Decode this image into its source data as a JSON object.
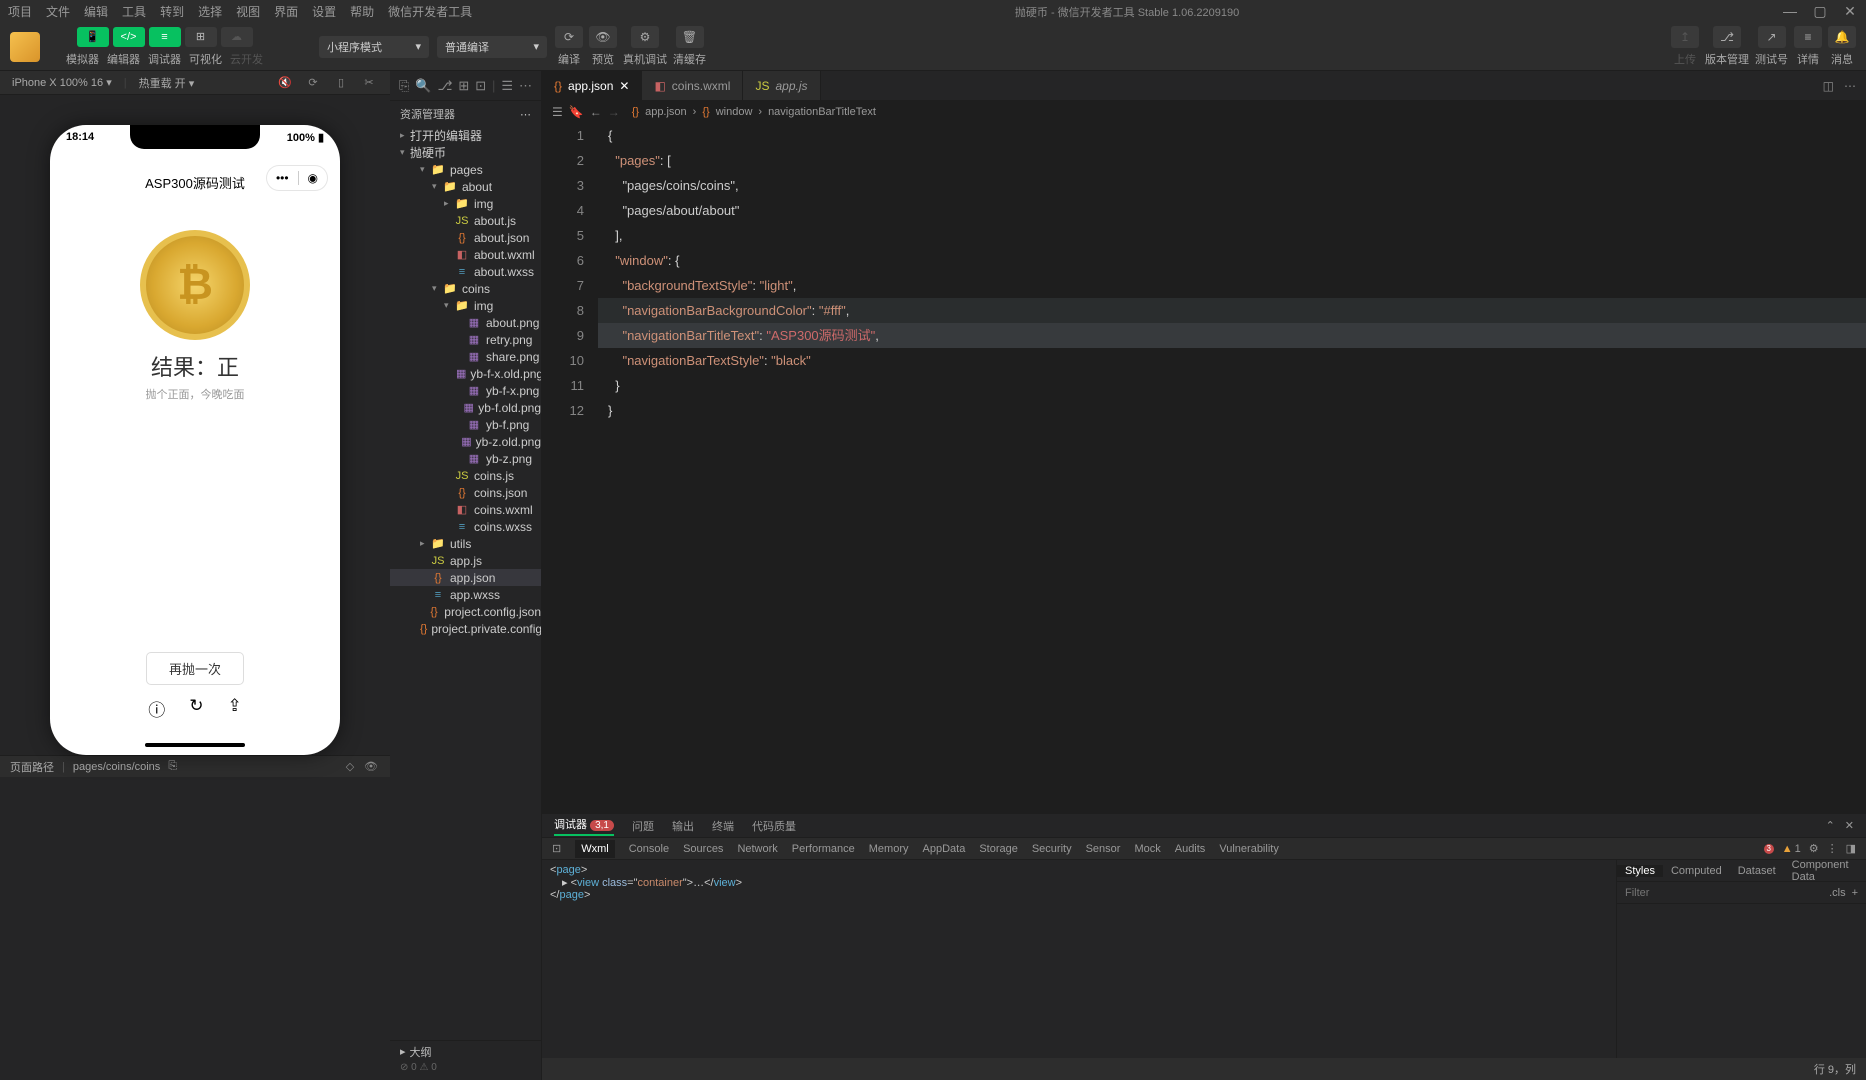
{
  "menubar": [
    "项目",
    "文件",
    "编辑",
    "工具",
    "转到",
    "选择",
    "视图",
    "界面",
    "设置",
    "帮助",
    "微信开发者工具"
  ],
  "window_title": "抛硬币 - 微信开发者工具 Stable 1.06.2209190",
  "toolbar": {
    "labels": [
      "模拟器",
      "编辑器",
      "调试器",
      "可视化",
      "云开发"
    ],
    "mode_dropdown": "小程序模式",
    "compile_dropdown": "普通编译",
    "compile_labels": [
      "编译",
      "预览",
      "真机调试",
      "清缓存"
    ],
    "right_labels": [
      "上传",
      "版本管理",
      "测试号",
      "详情",
      "消息"
    ]
  },
  "subheader": {
    "device": "iPhone X 100% 16",
    "hot_reload": "热重载 开"
  },
  "explorer": {
    "title": "资源管理器",
    "open_editors": "打开的编辑器",
    "project": "抛硬币",
    "outline": "大纲",
    "outline_stats": "⊘ 0 ⚠ 0"
  },
  "tree": [
    {
      "l": 2,
      "t": "folder",
      "c": "folder-yellow",
      "n": "pages",
      "exp": true
    },
    {
      "l": 3,
      "t": "folder",
      "c": "folder-yellow",
      "n": "about",
      "exp": true
    },
    {
      "l": 4,
      "t": "folder",
      "c": "folder-green",
      "n": "img",
      "exp": false
    },
    {
      "l": 4,
      "t": "file",
      "c": "js-yellow",
      "i": "JS",
      "n": "about.js"
    },
    {
      "l": 4,
      "t": "file",
      "c": "json-orange",
      "i": "{}",
      "n": "about.json"
    },
    {
      "l": 4,
      "t": "file",
      "c": "wxml-red",
      "i": "◧",
      "n": "about.wxml"
    },
    {
      "l": 4,
      "t": "file",
      "c": "wxss-blue",
      "i": "≡",
      "n": "about.wxss"
    },
    {
      "l": 3,
      "t": "folder",
      "c": "folder-yellow",
      "n": "coins",
      "exp": true
    },
    {
      "l": 4,
      "t": "folder",
      "c": "folder-green",
      "n": "img",
      "exp": true
    },
    {
      "l": 5,
      "t": "file",
      "c": "img-purple",
      "i": "▦",
      "n": "about.png"
    },
    {
      "l": 5,
      "t": "file",
      "c": "img-purple",
      "i": "▦",
      "n": "retry.png"
    },
    {
      "l": 5,
      "t": "file",
      "c": "img-purple",
      "i": "▦",
      "n": "share.png"
    },
    {
      "l": 5,
      "t": "file",
      "c": "img-purple",
      "i": "▦",
      "n": "yb-f-x.old.png"
    },
    {
      "l": 5,
      "t": "file",
      "c": "img-purple",
      "i": "▦",
      "n": "yb-f-x.png"
    },
    {
      "l": 5,
      "t": "file",
      "c": "img-purple",
      "i": "▦",
      "n": "yb-f.old.png"
    },
    {
      "l": 5,
      "t": "file",
      "c": "img-purple",
      "i": "▦",
      "n": "yb-f.png"
    },
    {
      "l": 5,
      "t": "file",
      "c": "img-purple",
      "i": "▦",
      "n": "yb-z.old.png"
    },
    {
      "l": 5,
      "t": "file",
      "c": "img-purple",
      "i": "▦",
      "n": "yb-z.png"
    },
    {
      "l": 4,
      "t": "file",
      "c": "js-yellow",
      "i": "JS",
      "n": "coins.js"
    },
    {
      "l": 4,
      "t": "file",
      "c": "json-orange",
      "i": "{}",
      "n": "coins.json"
    },
    {
      "l": 4,
      "t": "file",
      "c": "wxml-red",
      "i": "◧",
      "n": "coins.wxml"
    },
    {
      "l": 4,
      "t": "file",
      "c": "wxss-blue",
      "i": "≡",
      "n": "coins.wxss"
    },
    {
      "l": 2,
      "t": "folder",
      "c": "folder-yellow",
      "n": "utils",
      "exp": false
    },
    {
      "l": 2,
      "t": "file",
      "c": "js-yellow",
      "i": "JS",
      "n": "app.js"
    },
    {
      "l": 2,
      "t": "file",
      "c": "json-orange",
      "i": "{}",
      "n": "app.json",
      "sel": true
    },
    {
      "l": 2,
      "t": "file",
      "c": "wxss-blue",
      "i": "≡",
      "n": "app.wxss"
    },
    {
      "l": 2,
      "t": "file",
      "c": "json-orange",
      "i": "{}",
      "n": "project.config.json"
    },
    {
      "l": 2,
      "t": "file",
      "c": "json-orange",
      "i": "{}",
      "n": "project.private.config.js..."
    }
  ],
  "tabs": [
    {
      "icon": "{}",
      "color": "json-orange",
      "name": "app.json",
      "active": true,
      "close": true
    },
    {
      "icon": "◧",
      "color": "wxml-red",
      "name": "coins.wxml",
      "active": false
    },
    {
      "icon": "JS",
      "color": "js-yellow",
      "name": "app.js",
      "active": false,
      "italic": true
    }
  ],
  "breadcrumb": [
    "app.json",
    "{}",
    "window",
    "▢",
    "navigationBarTitleText"
  ],
  "code": {
    "lines": [
      "{",
      "  \"pages\": [",
      "    \"pages/coins/coins\",",
      "    \"pages/about/about\"",
      "  ],",
      "  \"window\": {",
      "    \"backgroundTextStyle\": \"light\",",
      "    \"navigationBarBackgroundColor\": \"#fff\",",
      "    \"navigationBarTitleText\": \"ASP300源码测试\",",
      "    \"navigationBarTextStyle\": \"black\"",
      "  }",
      "}"
    ]
  },
  "phone": {
    "time": "18:14",
    "battery": "100%",
    "title": "ASP300源码测试",
    "result_title": "结果：正",
    "result_sub": "抛个正面，今晚吃面",
    "button": "再抛一次"
  },
  "debugger": {
    "top_tabs": [
      "调试器",
      "问题",
      "输出",
      "终端",
      "代码质量"
    ],
    "badge": "3,1",
    "devtools_tabs": [
      "Wxml",
      "Console",
      "Sources",
      "Network",
      "Performance",
      "Memory",
      "AppData",
      "Storage",
      "Security",
      "Sensor",
      "Mock",
      "Audits",
      "Vulnerability"
    ],
    "err_count": "3",
    "warn_count": "1",
    "styles_tabs": [
      "Styles",
      "Computed",
      "Dataset",
      "Component Data"
    ],
    "filter_placeholder": "Filter",
    "cls": ".cls"
  },
  "statusbar": {
    "path_label": "页面路径",
    "path": "pages/coins/coins",
    "cursor": "行 9，列"
  }
}
